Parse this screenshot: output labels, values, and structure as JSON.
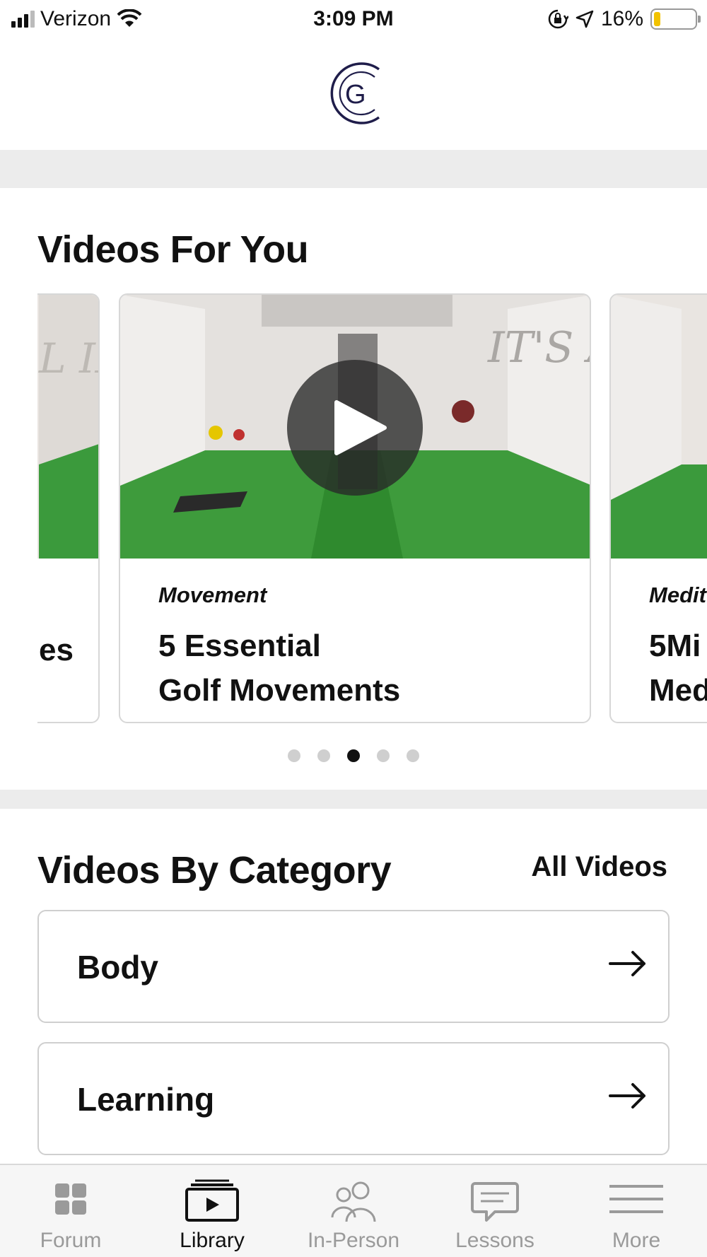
{
  "status_bar": {
    "carrier": "Verizon",
    "time": "3:09 PM",
    "battery": "16%",
    "battery_level": 0.16,
    "battery_color": "#f2c200"
  },
  "header": {
    "logo_letter": "G",
    "logo_color": "#1f1d4a"
  },
  "videos_for_you": {
    "title": "Videos For You",
    "cards": [
      {
        "category": "",
        "title": "es"
      },
      {
        "category": "Movement",
        "title_line1": "5 Essential",
        "title_line2": "Golf Movements"
      },
      {
        "category": "Medit",
        "title_line1": "5Mi",
        "title_line2": "Med"
      }
    ],
    "page_count": 5,
    "active_page": 2
  },
  "videos_by_category": {
    "title": "Videos By Category",
    "all_videos_label": "All Videos",
    "items": [
      {
        "label": "Body"
      },
      {
        "label": "Learning"
      }
    ]
  },
  "tab_bar": {
    "active_color": "#111111",
    "inactive_color": "#9a9a9a",
    "tabs": [
      {
        "label": "Forum",
        "icon": "grid-icon"
      },
      {
        "label": "Library",
        "icon": "video-library-icon"
      },
      {
        "label": "In-Person",
        "icon": "people-icon"
      },
      {
        "label": "Lessons",
        "icon": "chat-bubble-icon"
      },
      {
        "label": "More",
        "icon": "menu-icon"
      }
    ]
  }
}
